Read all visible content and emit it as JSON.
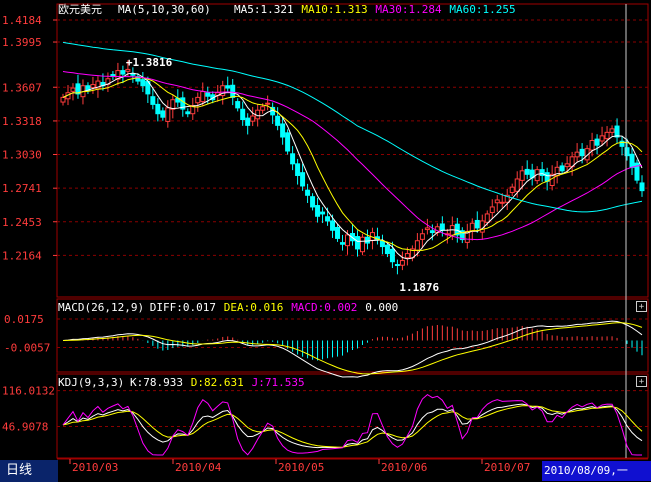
{
  "chart_data": {
    "type": "candlestick",
    "symbol": "欧元美元",
    "period_tab": "日线",
    "selected_date": "2010/08/09,一",
    "x_ticks": [
      "2010/03",
      "2010/04",
      "2010/05",
      "2010/06",
      "2010/07"
    ],
    "main": {
      "ma_params": "MA(5,10,30,60)",
      "ma_values": [
        {
          "name": "MA5",
          "value": "1.321",
          "color": "#ffffff"
        },
        {
          "name": "MA10",
          "value": "1.313",
          "color": "#ffff00"
        },
        {
          "name": "MA30",
          "value": "1.284",
          "color": "#ff00ff"
        },
        {
          "name": "MA60",
          "value": "1.255",
          "color": "#00ffff"
        }
      ],
      "y_ticks": [
        "1.4184",
        "1.3995",
        "1.3607",
        "1.3318",
        "1.3030",
        "1.2741",
        "1.2453",
        "1.2164"
      ],
      "ylim": [
        1.1876,
        1.4184
      ],
      "high_label": "1.3816",
      "low_label": "1.1876",
      "close": [
        1.352,
        1.356,
        1.36,
        1.355,
        1.362,
        1.358,
        1.363,
        1.366,
        1.362,
        1.368,
        1.37,
        1.375,
        1.372,
        1.376,
        1.371,
        1.366,
        1.362,
        1.355,
        1.346,
        1.338,
        1.335,
        1.343,
        1.35,
        1.348,
        1.342,
        1.338,
        1.345,
        1.352,
        1.357,
        1.353,
        1.35,
        1.356,
        1.362,
        1.36,
        1.352,
        1.343,
        1.333,
        1.328,
        1.336,
        1.341,
        1.344,
        1.347,
        1.337,
        1.328,
        1.318,
        1.306,
        1.295,
        1.285,
        1.276,
        1.268,
        1.258,
        1.25,
        1.252,
        1.246,
        1.238,
        1.231,
        1.226,
        1.234,
        1.229,
        1.222,
        1.232,
        1.227,
        1.236,
        1.23,
        1.224,
        1.218,
        1.211,
        1.208,
        1.212,
        1.218,
        1.222,
        1.229,
        1.235,
        1.24,
        1.236,
        1.241,
        1.238,
        1.235,
        1.242,
        1.234,
        1.23,
        1.237,
        1.244,
        1.24,
        1.246,
        1.252,
        1.258,
        1.264,
        1.262,
        1.268,
        1.275,
        1.282,
        1.289,
        1.286,
        1.283,
        1.29,
        1.285,
        1.28,
        1.286,
        1.292,
        1.289,
        1.295,
        1.301,
        1.305,
        1.302,
        1.308,
        1.315,
        1.311,
        1.319,
        1.322,
        1.325,
        1.318,
        1.31,
        1.302,
        1.292,
        1.281,
        1.272
      ]
    },
    "macd": {
      "label": "MACD(26,12,9)",
      "values": [
        {
          "name": "DIFF",
          "value": "0.017",
          "color": "#ffffff"
        },
        {
          "name": "DEA",
          "value": "0.016",
          "color": "#ffff00"
        },
        {
          "name": "MACD",
          "value": "0.002",
          "color": "#ff00ff"
        },
        {
          "name": "",
          "value": "0.000",
          "color": "#ffffff"
        }
      ],
      "y_ticks": [
        "0.0175",
        "-0.0057"
      ],
      "ylim": [
        -0.024,
        0.024
      ]
    },
    "kdj": {
      "label": "KDJ(9,3,3)",
      "values": [
        {
          "name": "K",
          "value": "78.933",
          "color": "#ffffff"
        },
        {
          "name": "D",
          "value": "82.631",
          "color": "#ffff00"
        },
        {
          "name": "J",
          "value": "71.535",
          "color": "#ff00ff"
        }
      ],
      "y_ticks": [
        "116.0132",
        "46.9078"
      ],
      "ylim": [
        -10,
        125
      ]
    },
    "colors": {
      "up": "#ff3c3c",
      "down": "#00ffff",
      "grid": "#8b0000",
      "border": "#a00000"
    }
  }
}
